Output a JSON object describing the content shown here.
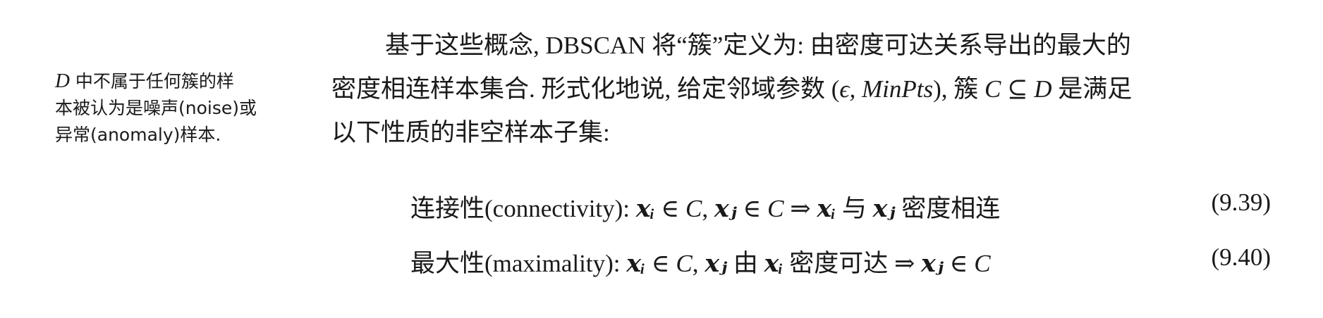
{
  "margin_note": {
    "var_d": "D",
    "line1_rest": " 中不属于任何簇的样",
    "line2": "本被认为是噪声(noise)或",
    "line3": "异常(anomaly)样本."
  },
  "paragraph": {
    "line1": "基于这些概念, DBSCAN 将“簇”定义为: 由密度可达关系导出的最大的",
    "line2_a": "密度相连样本集合. 形式化地说, 给定邻域参数 (",
    "line2_params": "ϵ, MinPts",
    "line2_b": "), 簇 ",
    "line2_c": "C",
    "line2_d": " ⊆ ",
    "line2_e": "D",
    "line2_f": " 是满足",
    "line3": "以下性质的非空样本子集:"
  },
  "equations": [
    {
      "label": "连接性(connectivity): ",
      "expr_parts": [
        "𝒙ᵢ",
        " ∈ ",
        "C",
        ", ",
        "𝒙ⱼ",
        " ∈ ",
        "C",
        " ⇒ ",
        "𝒙ᵢ",
        " 与 ",
        "𝒙ⱼ",
        " 密度相连"
      ],
      "number": "(9.39)"
    },
    {
      "label": "最大性(maximality): ",
      "expr_parts": [
        "𝒙ᵢ",
        " ∈ ",
        "C",
        ", ",
        "𝒙ⱼ",
        " 由 ",
        "𝒙ᵢ",
        " 密度可达 ",
        " ⇒ ",
        "𝒙ⱼ",
        " ∈ ",
        "C"
      ],
      "number": "(9.40)"
    }
  ]
}
